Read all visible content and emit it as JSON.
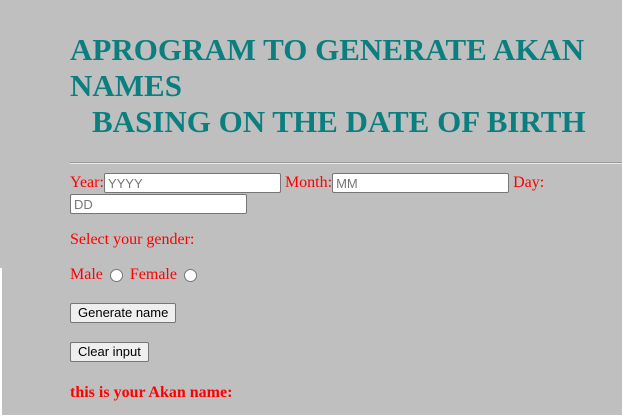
{
  "header": {
    "title_line1": "APROGRAM TO GENERATE AKAN NAMES",
    "title_line2": "BASING ON THE DATE OF BIRTH"
  },
  "form": {
    "year_label": "Year:",
    "year_placeholder": "YYYY",
    "year_value": "",
    "month_label": "Month:",
    "month_placeholder": "MM",
    "month_value": "",
    "day_label": "Day:",
    "day_placeholder": "DD",
    "day_value": "",
    "gender_prompt": "Select your gender:",
    "gender_options": [
      "Male",
      "Female"
    ],
    "generate_button": "Generate name",
    "clear_button": "Clear input"
  },
  "result": {
    "label": "this is your Akan name:"
  },
  "colors": {
    "background": "#bfbfbf",
    "title": "#0b7f7f",
    "label": "#ff0000"
  }
}
